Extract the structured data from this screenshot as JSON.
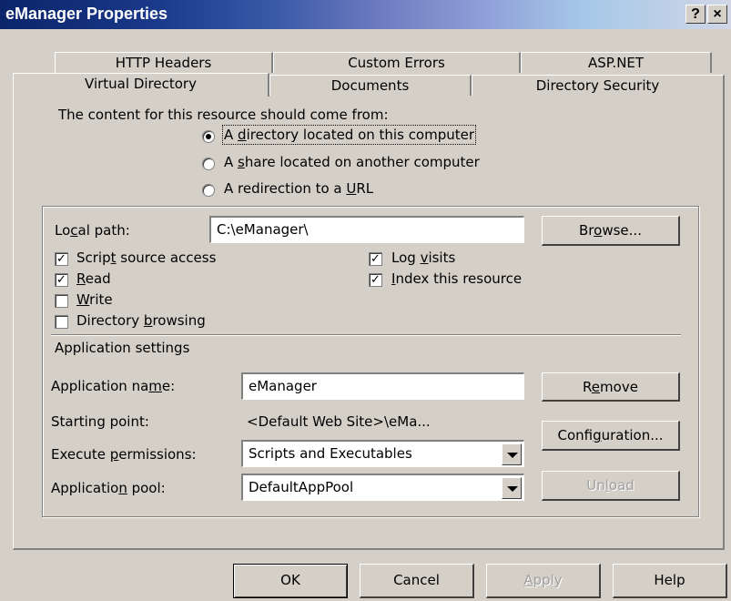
{
  "window": {
    "title": "eManager Properties",
    "help_glyph": "?",
    "close_glyph": "×"
  },
  "tabs_row1": [
    "HTTP Headers",
    "Custom Errors",
    "ASP.NET"
  ],
  "tabs_row2": [
    "Virtual Directory",
    "Documents",
    "Directory Security"
  ],
  "content_source": {
    "heading": "The content for this resource should come from:",
    "options": [
      {
        "pre": "A ",
        "key": "d",
        "post": "irectory located on this computer",
        "selected": true
      },
      {
        "pre": "A ",
        "key": "s",
        "post": "hare located on another computer",
        "selected": false
      },
      {
        "pre": "A redirection to a ",
        "key": "U",
        "post": "RL",
        "selected": false
      }
    ]
  },
  "local_path": {
    "label_pre": "Lo",
    "label_key": "c",
    "label_post": "al path:",
    "value": "C:\\eManager\\",
    "browse_pre": "Br",
    "browse_key": "o",
    "browse_post": "wse..."
  },
  "checks_left": [
    {
      "pre": "Scrip",
      "key": "t",
      "post": " source access",
      "checked": true
    },
    {
      "pre": "",
      "key": "R",
      "post": "ead",
      "checked": true
    },
    {
      "pre": "",
      "key": "W",
      "post": "rite",
      "checked": false
    },
    {
      "pre": "Directory ",
      "key": "b",
      "post": "rowsing",
      "checked": false
    }
  ],
  "checks_right": [
    {
      "pre": "Log ",
      "key": "v",
      "post": "isits",
      "checked": true
    },
    {
      "pre": "",
      "key": "I",
      "post": "ndex this resource",
      "checked": true
    }
  ],
  "app": {
    "section": "Application settings",
    "name_label_pre": "Application na",
    "name_label_key": "m",
    "name_label_post": "e:",
    "name_value": "eManager",
    "remove_pre": "R",
    "remove_key": "e",
    "remove_post": "move",
    "start_label": "Starting point:",
    "start_value": "<Default Web Site>\\eMa...",
    "config_pre": "Confi",
    "config_key": "g",
    "config_post": "uration...",
    "exec_label_pre": "Execute ",
    "exec_label_key": "p",
    "exec_label_post": "ermissions:",
    "exec_value": "Scripts and Executables",
    "pool_label_pre": "Applicatio",
    "pool_label_key": "n",
    "pool_label_post": " pool:",
    "pool_value": "DefaultAppPool",
    "unload_pre": "Un",
    "unload_key": "l",
    "unload_post": "oad"
  },
  "footer": {
    "ok": "OK",
    "cancel": "Cancel",
    "apply_key": "A",
    "apply_post": "pply",
    "help": "Help"
  }
}
